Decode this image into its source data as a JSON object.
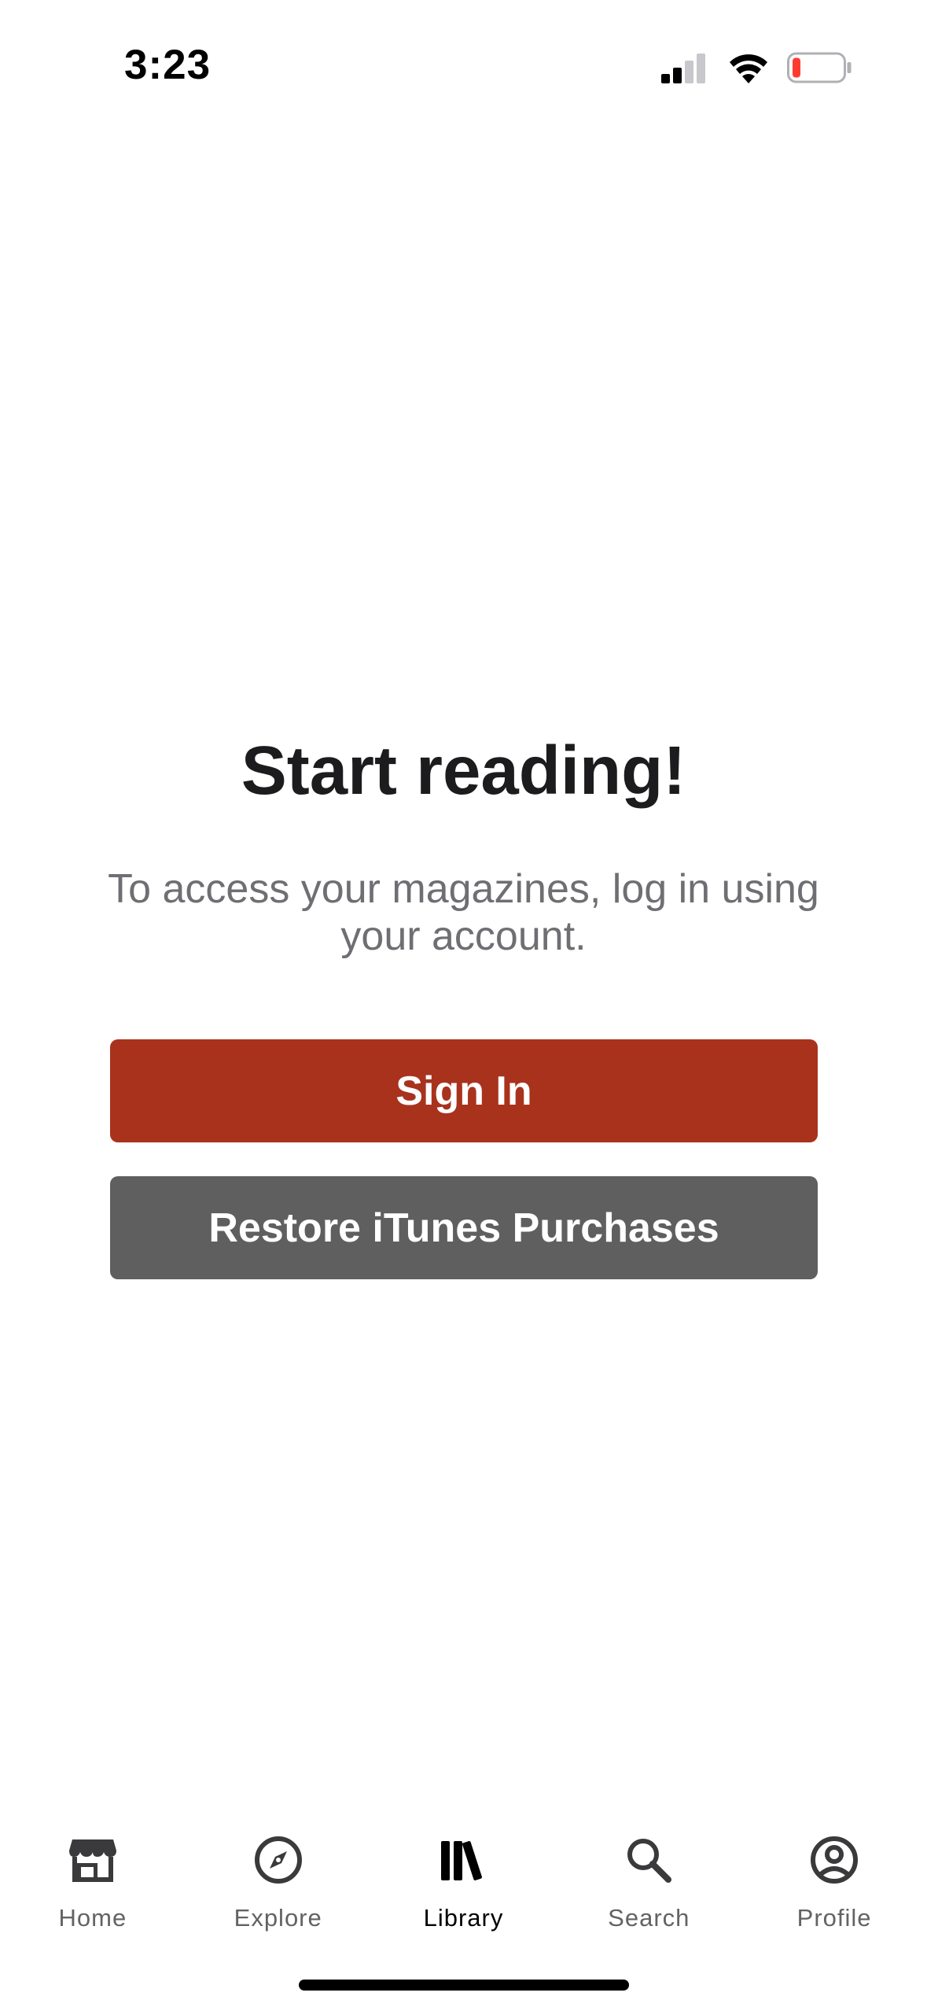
{
  "status_bar": {
    "time": "3:23",
    "signal_icon": "cellular-signal-icon",
    "wifi_icon": "wifi-icon",
    "battery_icon": "battery-low-icon",
    "battery_color": "#ff3b30"
  },
  "main": {
    "headline": "Start reading!",
    "subtext": "To access your magazines, log in using your account.",
    "sign_in_label": "Sign In",
    "restore_label": "Restore iTunes Purchases"
  },
  "colors": {
    "sign_in_button": "#a9321d",
    "restore_button": "#5f5f5f",
    "tab_active": "#000000",
    "tab_inactive": "#636366"
  },
  "tab_bar": {
    "active_tab": "Library",
    "items": [
      {
        "label": "Home",
        "icon": "store-icon"
      },
      {
        "label": "Explore",
        "icon": "compass-icon"
      },
      {
        "label": "Library",
        "icon": "library-books-icon"
      },
      {
        "label": "Search",
        "icon": "search-icon"
      },
      {
        "label": "Profile",
        "icon": "profile-circle-icon"
      }
    ]
  }
}
